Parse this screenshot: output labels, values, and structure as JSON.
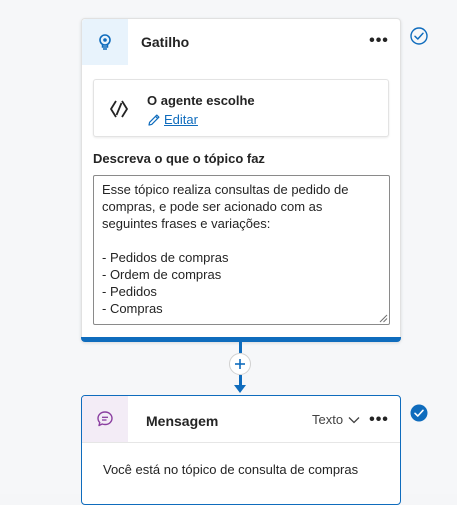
{
  "trigger_card": {
    "title": "Gatilho",
    "more_label": "•••",
    "agent": {
      "title": "O agente escolhe",
      "edit_label": "Editar"
    },
    "description_label": "Descreva o que o tópico faz",
    "description_value": "Esse tópico realiza consultas de pedido de compras, e pode ser acionado com as seguintes frases e variações:\n\n- Pedidos de compras\n- Ordem de compras\n- Pedidos\n- Compras",
    "status_icon": "check-circle-outline-icon"
  },
  "connector": {
    "add_icon": "plus-icon",
    "add_label": "+"
  },
  "message_card": {
    "title": "Mensagem",
    "type_label": "Texto",
    "more_label": "•••",
    "text": "Você está no tópico de consulta de compras",
    "status_icon": "check-circle-filled-icon"
  },
  "colors": {
    "accent": "#0f6cbd",
    "trigger_icon_bg": "#e8f3fc",
    "message_icon_bg": "#f3ecf6",
    "message_icon": "#8a3ea0",
    "canvas_bg": "#f6f7f9"
  }
}
